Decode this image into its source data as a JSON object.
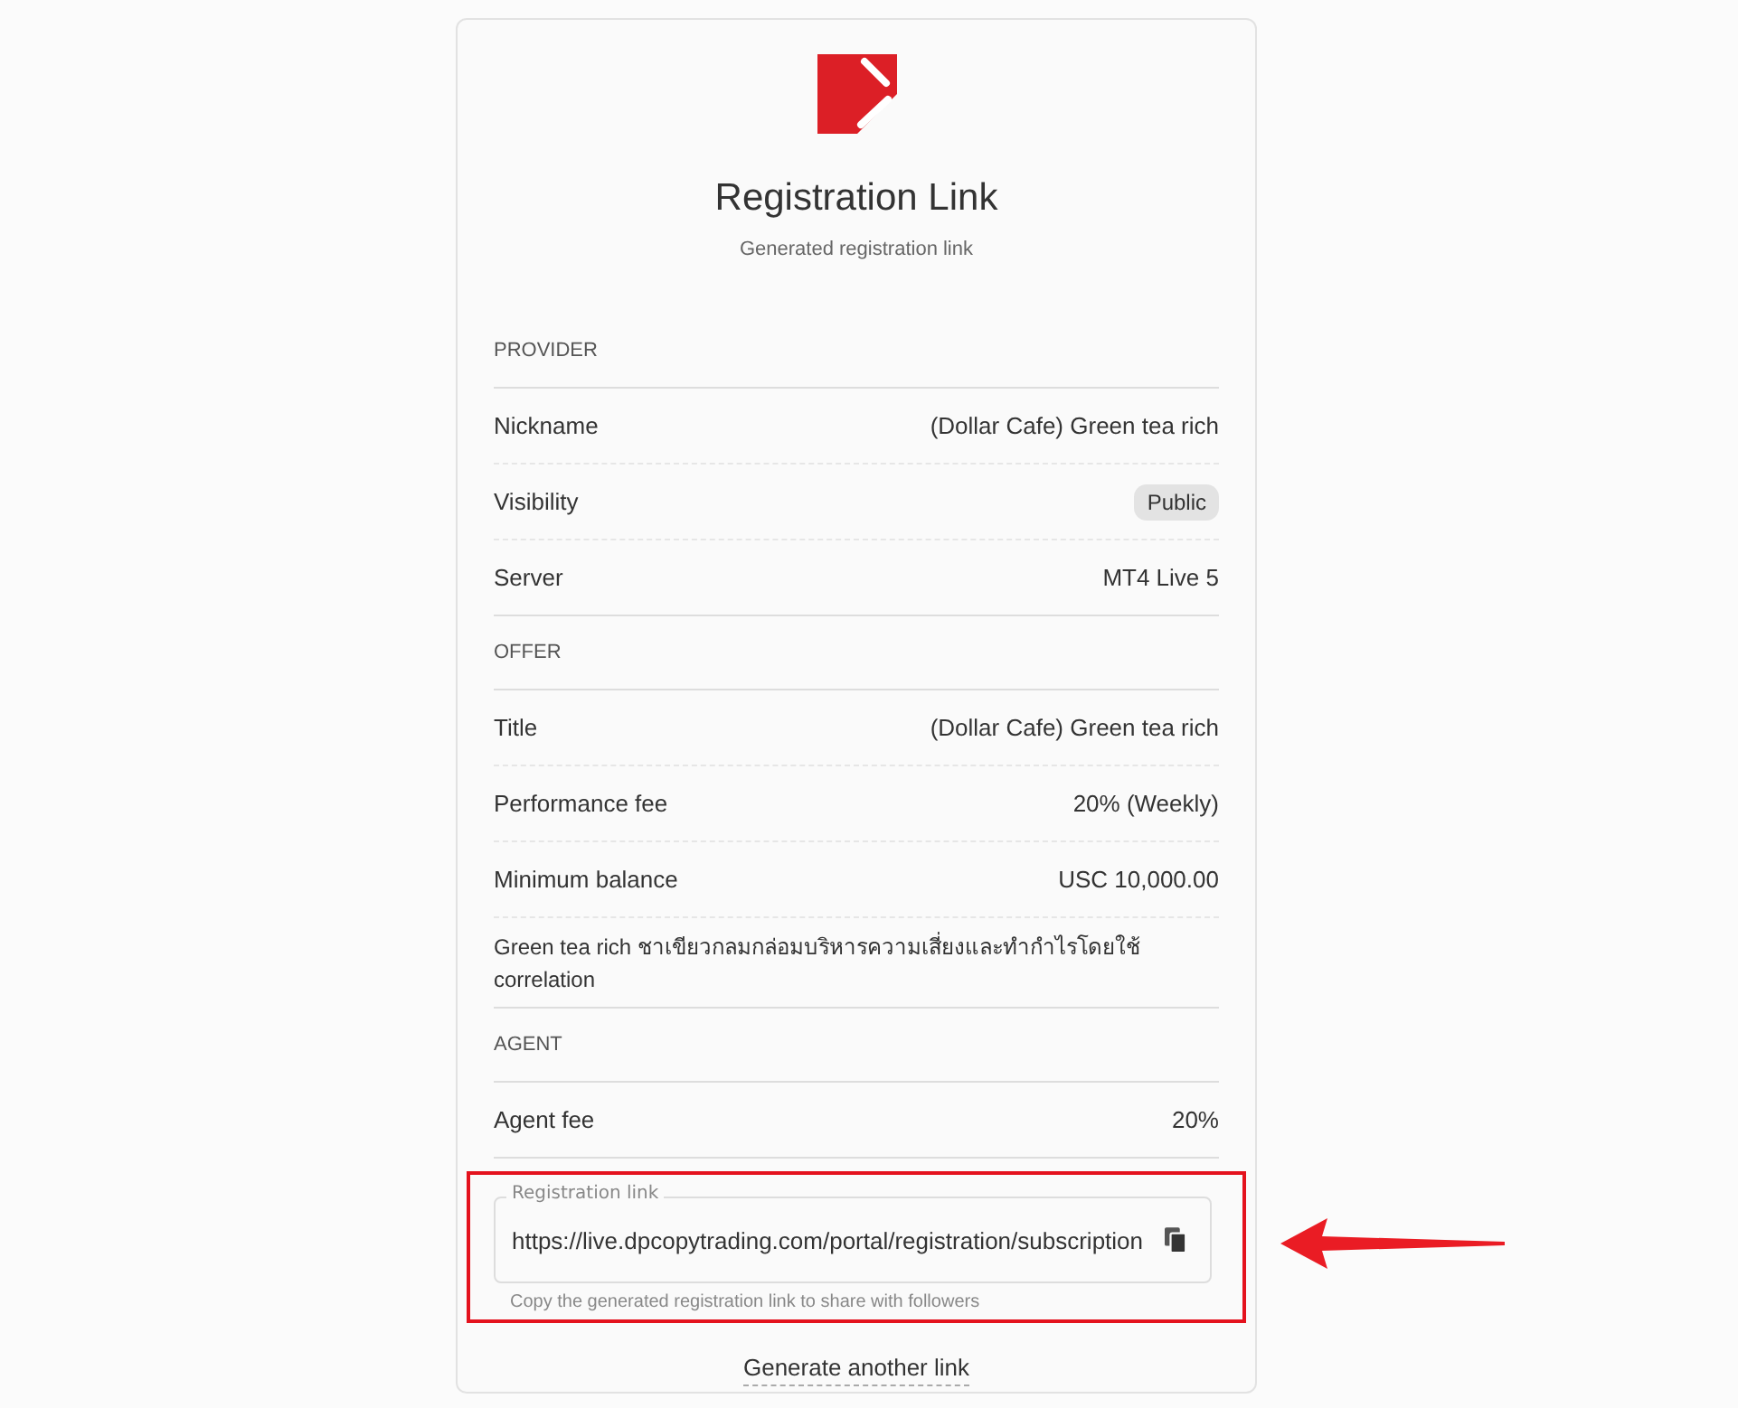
{
  "header": {
    "title": "Registration Link",
    "subtitle": "Generated registration link"
  },
  "sections": [
    {
      "heading": "PROVIDER",
      "rows": [
        {
          "kind": "text",
          "label": "Nickname",
          "value": "(Dollar Cafe) Green tea rich"
        },
        {
          "kind": "badge",
          "label": "Visibility",
          "value": "Public"
        },
        {
          "kind": "text",
          "label": "Server",
          "value": "MT4 Live 5"
        }
      ]
    },
    {
      "heading": "OFFER",
      "rows": [
        {
          "kind": "text",
          "label": "Title",
          "value": "(Dollar Cafe) Green tea rich"
        },
        {
          "kind": "text",
          "label": "Performance fee",
          "value": "20% (Weekly)"
        },
        {
          "kind": "text",
          "label": "Minimum balance",
          "value": "USC 10,000.00"
        },
        {
          "kind": "note",
          "text": "Green tea rich ชาเขียวกลมกล่อมบริหารความเสี่ยงและทำกำไรโดยใช้ correlation"
        }
      ]
    },
    {
      "heading": "AGENT",
      "rows": [
        {
          "kind": "text",
          "label": "Agent fee",
          "value": "20%"
        }
      ]
    }
  ],
  "link_field": {
    "label": "Registration link",
    "value": "https://live.dpcopytrading.com/portal/registration/subscription",
    "helper": "Copy the generated registration link to share with followers",
    "highlighted": true
  },
  "generate_link": "Generate another link"
}
